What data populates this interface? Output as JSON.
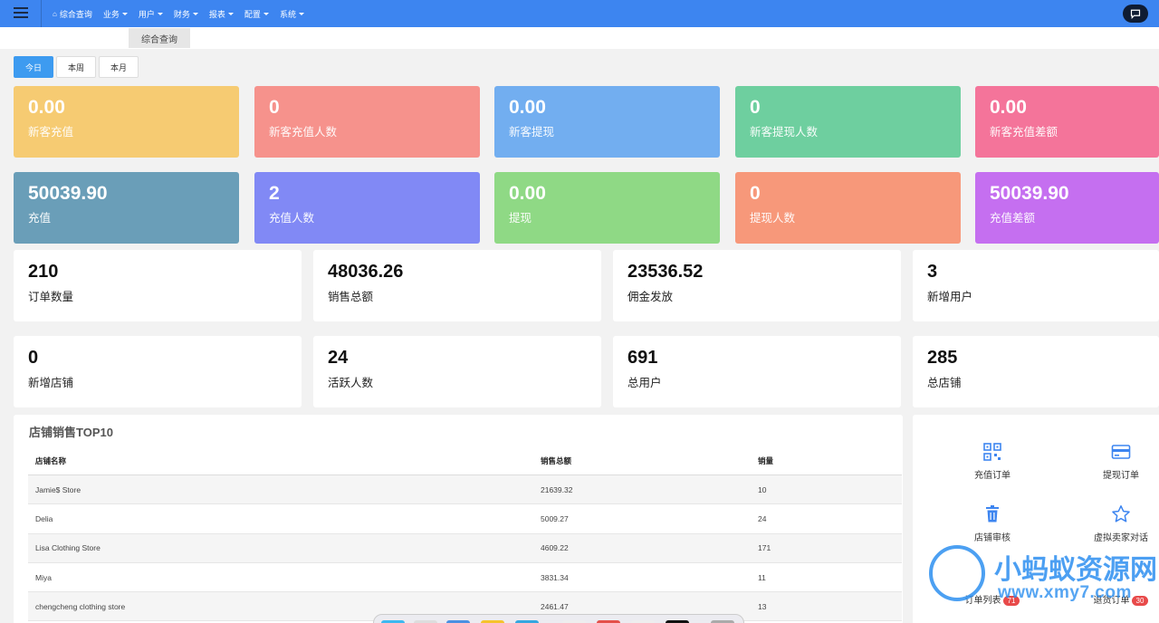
{
  "topbar": {
    "nav": [
      {
        "label": "综合查询",
        "icon": "home-icon",
        "caret": false
      },
      {
        "label": "业务",
        "caret": true
      },
      {
        "label": "用户",
        "caret": true
      },
      {
        "label": "财务",
        "caret": true
      },
      {
        "label": "报表",
        "caret": true
      },
      {
        "label": "配置",
        "caret": true
      },
      {
        "label": "系统",
        "caret": true
      }
    ],
    "accent": "#3d85f0"
  },
  "tabs": {
    "active": "综合查询"
  },
  "period_buttons": [
    {
      "label": "今日",
      "active": true
    },
    {
      "label": "本周",
      "active": false
    },
    {
      "label": "本月",
      "active": false
    }
  ],
  "color_cards": [
    {
      "value": "0.00",
      "label": "新客充值",
      "color": "#f6cb72"
    },
    {
      "value": "0",
      "label": "新客充值人数",
      "color": "#f6928c"
    },
    {
      "value": "0.00",
      "label": "新客提现",
      "color": "#72aef0"
    },
    {
      "value": "0",
      "label": "新客提现人数",
      "color": "#6ecf9f"
    },
    {
      "value": "0.00",
      "label": "新客充值差额",
      "color": "#f4749a"
    },
    {
      "value": "50039.90",
      "label": "充值",
      "color": "#6a9eb8"
    },
    {
      "value": "2",
      "label": "充值人数",
      "color": "#8189f5"
    },
    {
      "value": "0.00",
      "label": "提现",
      "color": "#8fd985"
    },
    {
      "value": "0",
      "label": "提现人数",
      "color": "#f7987a"
    },
    {
      "value": "50039.90",
      "label": "充值差额",
      "color": "#c56ff0"
    }
  ],
  "stat_cards": [
    {
      "value": "210",
      "label": "订单数量"
    },
    {
      "value": "48036.26",
      "label": "销售总额"
    },
    {
      "value": "23536.52",
      "label": "佣金发放"
    },
    {
      "value": "3",
      "label": "新增用户"
    },
    {
      "value": "0",
      "label": "新增店铺"
    },
    {
      "value": "24",
      "label": "活跃人数"
    },
    {
      "value": "691",
      "label": "总用户"
    },
    {
      "value": "285",
      "label": "总店铺"
    }
  ],
  "top_stores": {
    "title": "店铺销售TOP10",
    "columns": [
      "店铺名称",
      "销售总额",
      "销量"
    ],
    "rows": [
      [
        "Jamie$ Store",
        "21639.32",
        "10"
      ],
      [
        "Delia",
        "5009.27",
        "24"
      ],
      [
        "Lisa Clothing Store",
        "4609.22",
        "171"
      ],
      [
        "Miya",
        "3831.34",
        "11"
      ],
      [
        "chengcheng clothing store",
        "2461.47",
        "13"
      ]
    ]
  },
  "quick_links": [
    {
      "label": "充值订单",
      "icon": "qrcode-icon"
    },
    {
      "label": "提现订单",
      "icon": "card-icon"
    },
    {
      "label": "店铺审核",
      "icon": "trash-icon"
    },
    {
      "label": "虚拟卖家对话",
      "icon": "star-icon"
    },
    {
      "label": "订单列表",
      "badge": "71",
      "badge_color": "#e84a4a"
    },
    {
      "label": "退货订单",
      "badge": "30",
      "badge_color": "#e84a4a"
    }
  ],
  "watermark": {
    "line1": "小蚂蚁资源网",
    "line2": "www.xmy7.com"
  }
}
